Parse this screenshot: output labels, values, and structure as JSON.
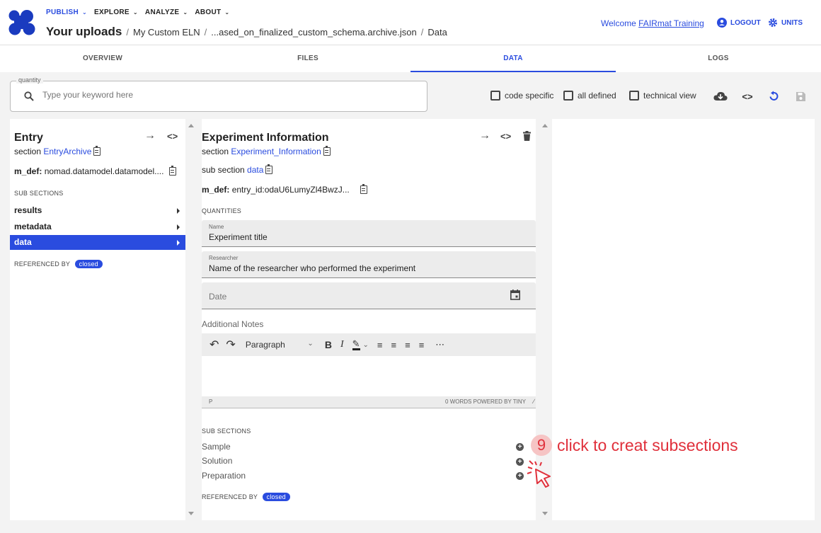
{
  "header": {
    "menu": [
      "PUBLISH",
      "EXPLORE",
      "ANALYZE",
      "ABOUT"
    ],
    "breadcrumb_root": "Your uploads",
    "breadcrumbs": [
      "My Custom ELN",
      "...ased_on_finalized_custom_schema.archive.json",
      "Data"
    ],
    "welcome_prefix": "Welcome",
    "welcome_user": "FAIRmat Training",
    "logout": "LOGOUT",
    "units": "UNITS"
  },
  "tabs": [
    "OVERVIEW",
    "FILES",
    "DATA",
    "LOGS"
  ],
  "search": {
    "label": "quantity",
    "placeholder": "Type your keyword here"
  },
  "options": {
    "code_specific": "code specific",
    "all_defined": "all defined",
    "technical_view": "technical view"
  },
  "entry_panel": {
    "title": "Entry",
    "section_label": "section",
    "section_link": "EntryArchive",
    "mdef_label": "m_def:",
    "mdef_value": "nomad.datamodel.datamodel....",
    "subsections_title": "SUB SECTIONS",
    "items": [
      "results",
      "metadata",
      "data"
    ],
    "referenced_by": "REFERENCED BY",
    "closed": "closed"
  },
  "experiment_panel": {
    "title": "Experiment Information",
    "section_label": "section",
    "section_link": "Experiment_Information",
    "subsection_label": "sub section",
    "subsection_link": "data",
    "mdef_label": "m_def:",
    "mdef_value": "entry_id:odaU6LumyZl4BwzJ...",
    "quantities_title": "QUANTITIES",
    "name_label": "Name",
    "name_value": "Experiment title",
    "researcher_label": "Researcher",
    "researcher_value": "Name of the researcher who performed the experiment",
    "date_placeholder": "Date",
    "notes_label": "Additional Notes",
    "paragraph": "Paragraph",
    "status_left": "P",
    "status_right": "0 WORDS  POWERED BY TINY",
    "subsections_title": "SUB SECTIONS",
    "subsections": [
      "Sample",
      "Solution",
      "Preparation"
    ],
    "referenced_by": "REFERENCED BY",
    "closed": "closed"
  },
  "annotation": {
    "number": "9",
    "text": "click to creat subsections"
  },
  "colors": {
    "accent": "#2a4cdf",
    "annotation": "#e0303b"
  }
}
